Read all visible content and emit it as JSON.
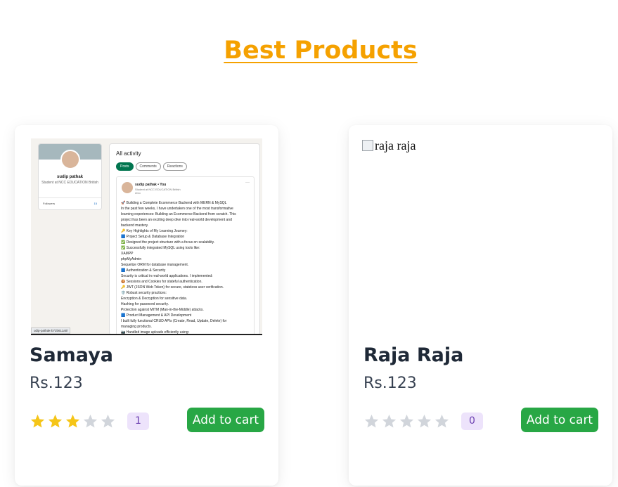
{
  "section": {
    "title": "Best Products"
  },
  "colors": {
    "title": "#f5a100",
    "star_filled": "#f5c518",
    "star_empty": "#d1d5db",
    "button": "#28a745",
    "badge_bg": "#ede3fb",
    "badge_text": "#6b3fb0"
  },
  "products": [
    {
      "name": "Samaya",
      "price": "Rs.123",
      "rating": 3,
      "max_rating": 5,
      "review_count": "1",
      "add_to_cart_label": "Add to cart",
      "image_alt": "",
      "thumbnail": {
        "profile_name": "sudip pathak",
        "profile_sub": "Student at NCC EDUCATION British",
        "followers_label": "Followers",
        "followers_count": "15",
        "heading": "All activity",
        "pills": [
          "Posts",
          "Comments",
          "Reactions"
        ],
        "post_author": "sudip pathak • You",
        "post_sub": "Student at NCC EDUCATION British",
        "post_time": "2mo",
        "more": "···",
        "lines": [
          "🚀 Building a Complete Ecommerce Backend with MERN & MySQL",
          "In the past few weeks, I have undertaken one of the most transformative",
          "learning experiences: Building an Ecommerce Backend from scratch. This",
          "project has been an exciting deep dive into real-world development and",
          "backend mastery.",
          "🔑 Key Highlights of My Learning Journey:",
          "🟦 Project Setup & Database Integration",
          "✅ Designed the project structure with a focus on scalability.",
          "✅ Successfully integrated MySQL using tools like:",
          "XAMPP",
          "phpMyAdmin",
          "Sequelize ORM for database management.",
          "🟦 Authentication & Security",
          "Security is critical in real-world applications. I implemented:",
          "🍪 Sessions and Cookies for stateful authentication.",
          "🔑 JWT (JSON Web Token) for secure, stateless user verification.",
          "🛡️ Robust security practices:",
          "Encryption & Decryption for sensitive data.",
          "Hashing for password security.",
          "Protection against MITM (Man-in-the-Middle) attacks.",
          "🟦 Product Management & API Development",
          "I built fully functional CRUD APIs (Create, Read, Update, Delete) for",
          "managing products.",
          "📷 Handled image uploads efficiently using:"
        ],
        "url": "udip-pathak-b72b611a0/"
      }
    },
    {
      "name": "Raja Raja",
      "price": "Rs.123",
      "rating": 0,
      "max_rating": 5,
      "review_count": "0",
      "add_to_cart_label": "Add to cart",
      "image_alt": "raja raja"
    }
  ]
}
